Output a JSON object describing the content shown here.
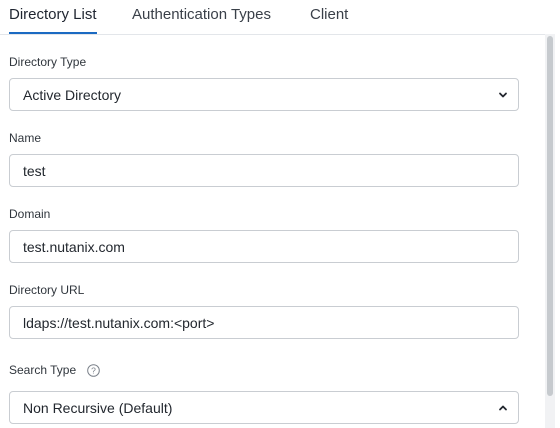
{
  "tabs": [
    {
      "label": "Directory List",
      "active": true
    },
    {
      "label": "Authentication Types",
      "active": false
    },
    {
      "label": "Client",
      "active": false
    }
  ],
  "form": {
    "directory_type": {
      "label": "Directory Type",
      "value": "Active Directory"
    },
    "name": {
      "label": "Name",
      "value": "test"
    },
    "domain": {
      "label": "Domain",
      "value": "test.nutanix.com"
    },
    "directory_url": {
      "label": "Directory URL",
      "value": "ldaps://test.nutanix.com:<port>"
    },
    "search_type": {
      "label": "Search Type",
      "value": "Non Recursive (Default)",
      "help_icon": "question-circle-icon"
    }
  },
  "colors": {
    "accent": "#1b6ac2",
    "border": "#c9cdd2"
  }
}
